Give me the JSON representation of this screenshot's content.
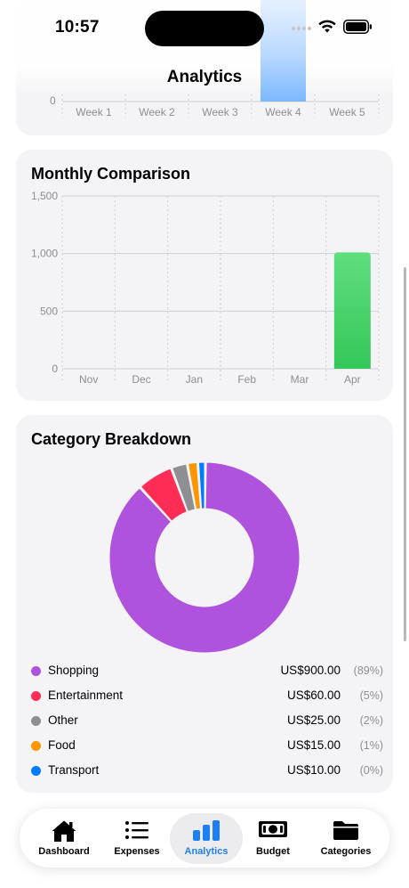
{
  "status_bar": {
    "time": "10:57"
  },
  "nav": {
    "title": "Analytics"
  },
  "weekly": {
    "y_tick": "0",
    "labels": [
      "Week 1",
      "Week 2",
      "Week 3",
      "Week 4",
      "Week 5"
    ]
  },
  "monthly": {
    "title": "Monthly Comparison"
  },
  "category": {
    "title": "Category Breakdown",
    "items": [
      {
        "name": "Shopping",
        "amount": "US$900.00",
        "pct": "(89%)",
        "color": "#af52de"
      },
      {
        "name": "Entertainment",
        "amount": "US$60.00",
        "pct": "(5%)",
        "color": "#ff2d55"
      },
      {
        "name": "Other",
        "amount": "US$25.00",
        "pct": "(2%)",
        "color": "#8e8e93"
      },
      {
        "name": "Food",
        "amount": "US$15.00",
        "pct": "(1%)",
        "color": "#ff9500"
      },
      {
        "name": "Transport",
        "amount": "US$10.00",
        "pct": "(0%)",
        "color": "#007aff"
      }
    ]
  },
  "chart_data": [
    {
      "type": "bar",
      "title": "Monthly Comparison",
      "categories": [
        "Nov",
        "Dec",
        "Jan",
        "Feb",
        "Mar",
        "Apr"
      ],
      "values": [
        0,
        0,
        0,
        0,
        0,
        1010
      ],
      "ylim": [
        0,
        1500
      ],
      "y_ticks": [
        "0",
        "500",
        "1,000",
        "1,500"
      ],
      "y_tick_values": [
        0,
        500,
        1000,
        1500
      ],
      "grid": true,
      "bar_color": "#34c759"
    },
    {
      "type": "pie",
      "title": "Category Breakdown",
      "donut": true,
      "labels": [
        "Shopping",
        "Entertainment",
        "Other",
        "Food",
        "Transport"
      ],
      "values": [
        900,
        60,
        25,
        15,
        10
      ],
      "colors": [
        "#af52de",
        "#ff2d55",
        "#8e8e93",
        "#ff9500",
        "#007aff"
      ]
    }
  ],
  "tabs": [
    {
      "label": "Dashboard",
      "icon": "house-icon",
      "active": false
    },
    {
      "label": "Expenses",
      "icon": "list-icon",
      "active": false
    },
    {
      "label": "Analytics",
      "icon": "bar-chart-icon",
      "active": true
    },
    {
      "label": "Budget",
      "icon": "banknote-icon",
      "active": false
    },
    {
      "label": "Categories",
      "icon": "folder-icon",
      "active": false
    }
  ]
}
